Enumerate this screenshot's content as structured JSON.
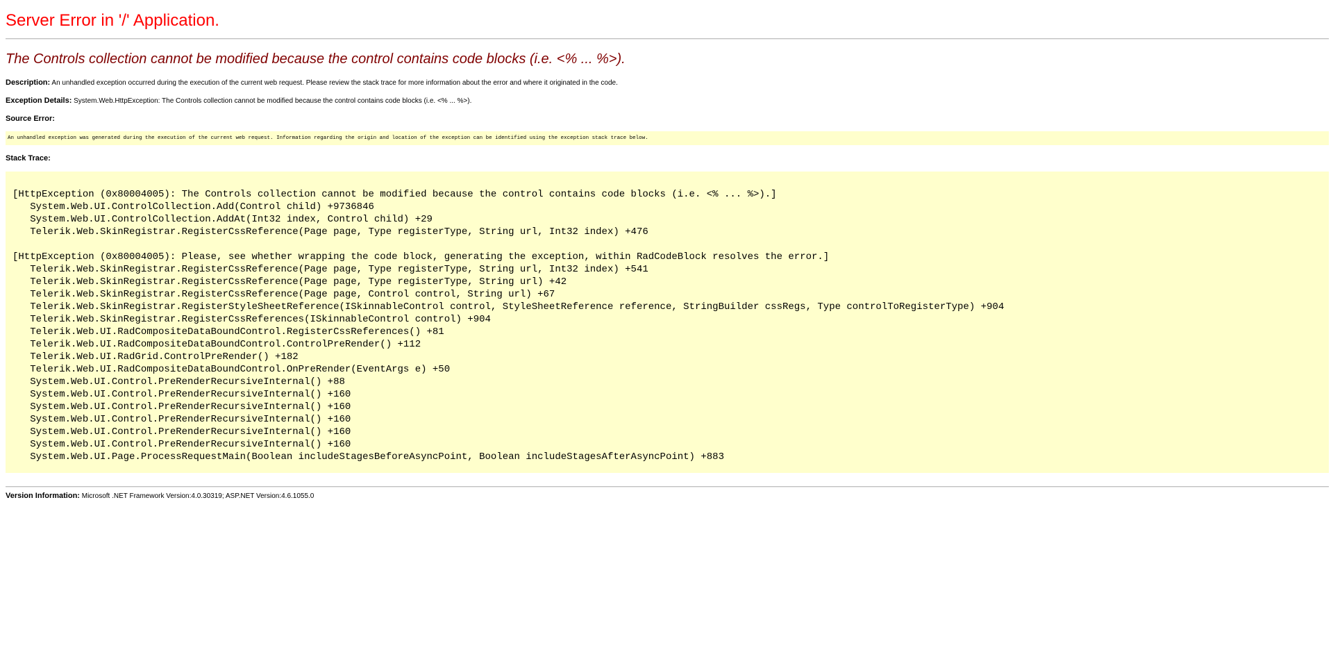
{
  "page": {
    "title": "Server Error in '/' Application.",
    "subtitle": "The Controls collection cannot be modified because the control contains code blocks (i.e. <% ... %>)."
  },
  "description": {
    "label": "Description:",
    "text": "An unhandled exception occurred during the execution of the current web request. Please review the stack trace for more information about the error and where it originated in the code."
  },
  "exception_details": {
    "label": "Exception Details:",
    "text": "System.Web.HttpException: The Controls collection cannot be modified because the control contains code blocks (i.e. <% ... %>)."
  },
  "source_error": {
    "label": "Source Error:",
    "text": "An unhandled exception was generated during the execution of the current web request. Information regarding the origin and location of the exception can be identified using the exception stack trace below."
  },
  "stack_trace": {
    "label": "Stack Trace:",
    "text": "[HttpException (0x80004005): The Controls collection cannot be modified because the control contains code blocks (i.e. <% ... %>).]\n   System.Web.UI.ControlCollection.Add(Control child) +9736846\n   System.Web.UI.ControlCollection.AddAt(Int32 index, Control child) +29\n   Telerik.Web.SkinRegistrar.RegisterCssReference(Page page, Type registerType, String url, Int32 index) +476\n\n[HttpException (0x80004005): Please, see whether wrapping the code block, generating the exception, within RadCodeBlock resolves the error.]\n   Telerik.Web.SkinRegistrar.RegisterCssReference(Page page, Type registerType, String url, Int32 index) +541\n   Telerik.Web.SkinRegistrar.RegisterCssReference(Page page, Type registerType, String url) +42\n   Telerik.Web.SkinRegistrar.RegisterCssReference(Page page, Control control, String url) +67\n   Telerik.Web.SkinRegistrar.RegisterStyleSheetReference(ISkinnableControl control, StyleSheetReference reference, StringBuilder cssRegs, Type controlToRegisterType) +904\n   Telerik.Web.SkinRegistrar.RegisterCssReferences(ISkinnableControl control) +904\n   Telerik.Web.UI.RadCompositeDataBoundControl.RegisterCssReferences() +81\n   Telerik.Web.UI.RadCompositeDataBoundControl.ControlPreRender() +112\n   Telerik.Web.UI.RadGrid.ControlPreRender() +182\n   Telerik.Web.UI.RadCompositeDataBoundControl.OnPreRender(EventArgs e) +50\n   System.Web.UI.Control.PreRenderRecursiveInternal() +88\n   System.Web.UI.Control.PreRenderRecursiveInternal() +160\n   System.Web.UI.Control.PreRenderRecursiveInternal() +160\n   System.Web.UI.Control.PreRenderRecursiveInternal() +160\n   System.Web.UI.Control.PreRenderRecursiveInternal() +160\n   System.Web.UI.Control.PreRenderRecursiveInternal() +160\n   System.Web.UI.Page.ProcessRequestMain(Boolean includeStagesBeforeAsyncPoint, Boolean includeStagesAfterAsyncPoint) +883"
  },
  "version_info": {
    "label": "Version Information:",
    "text": "Microsoft .NET Framework Version:4.0.30319; ASP.NET Version:4.6.1055.0"
  },
  "colors": {
    "title": "#ff0000",
    "subtitle": "#800000",
    "code_background": "#ffffcc"
  }
}
